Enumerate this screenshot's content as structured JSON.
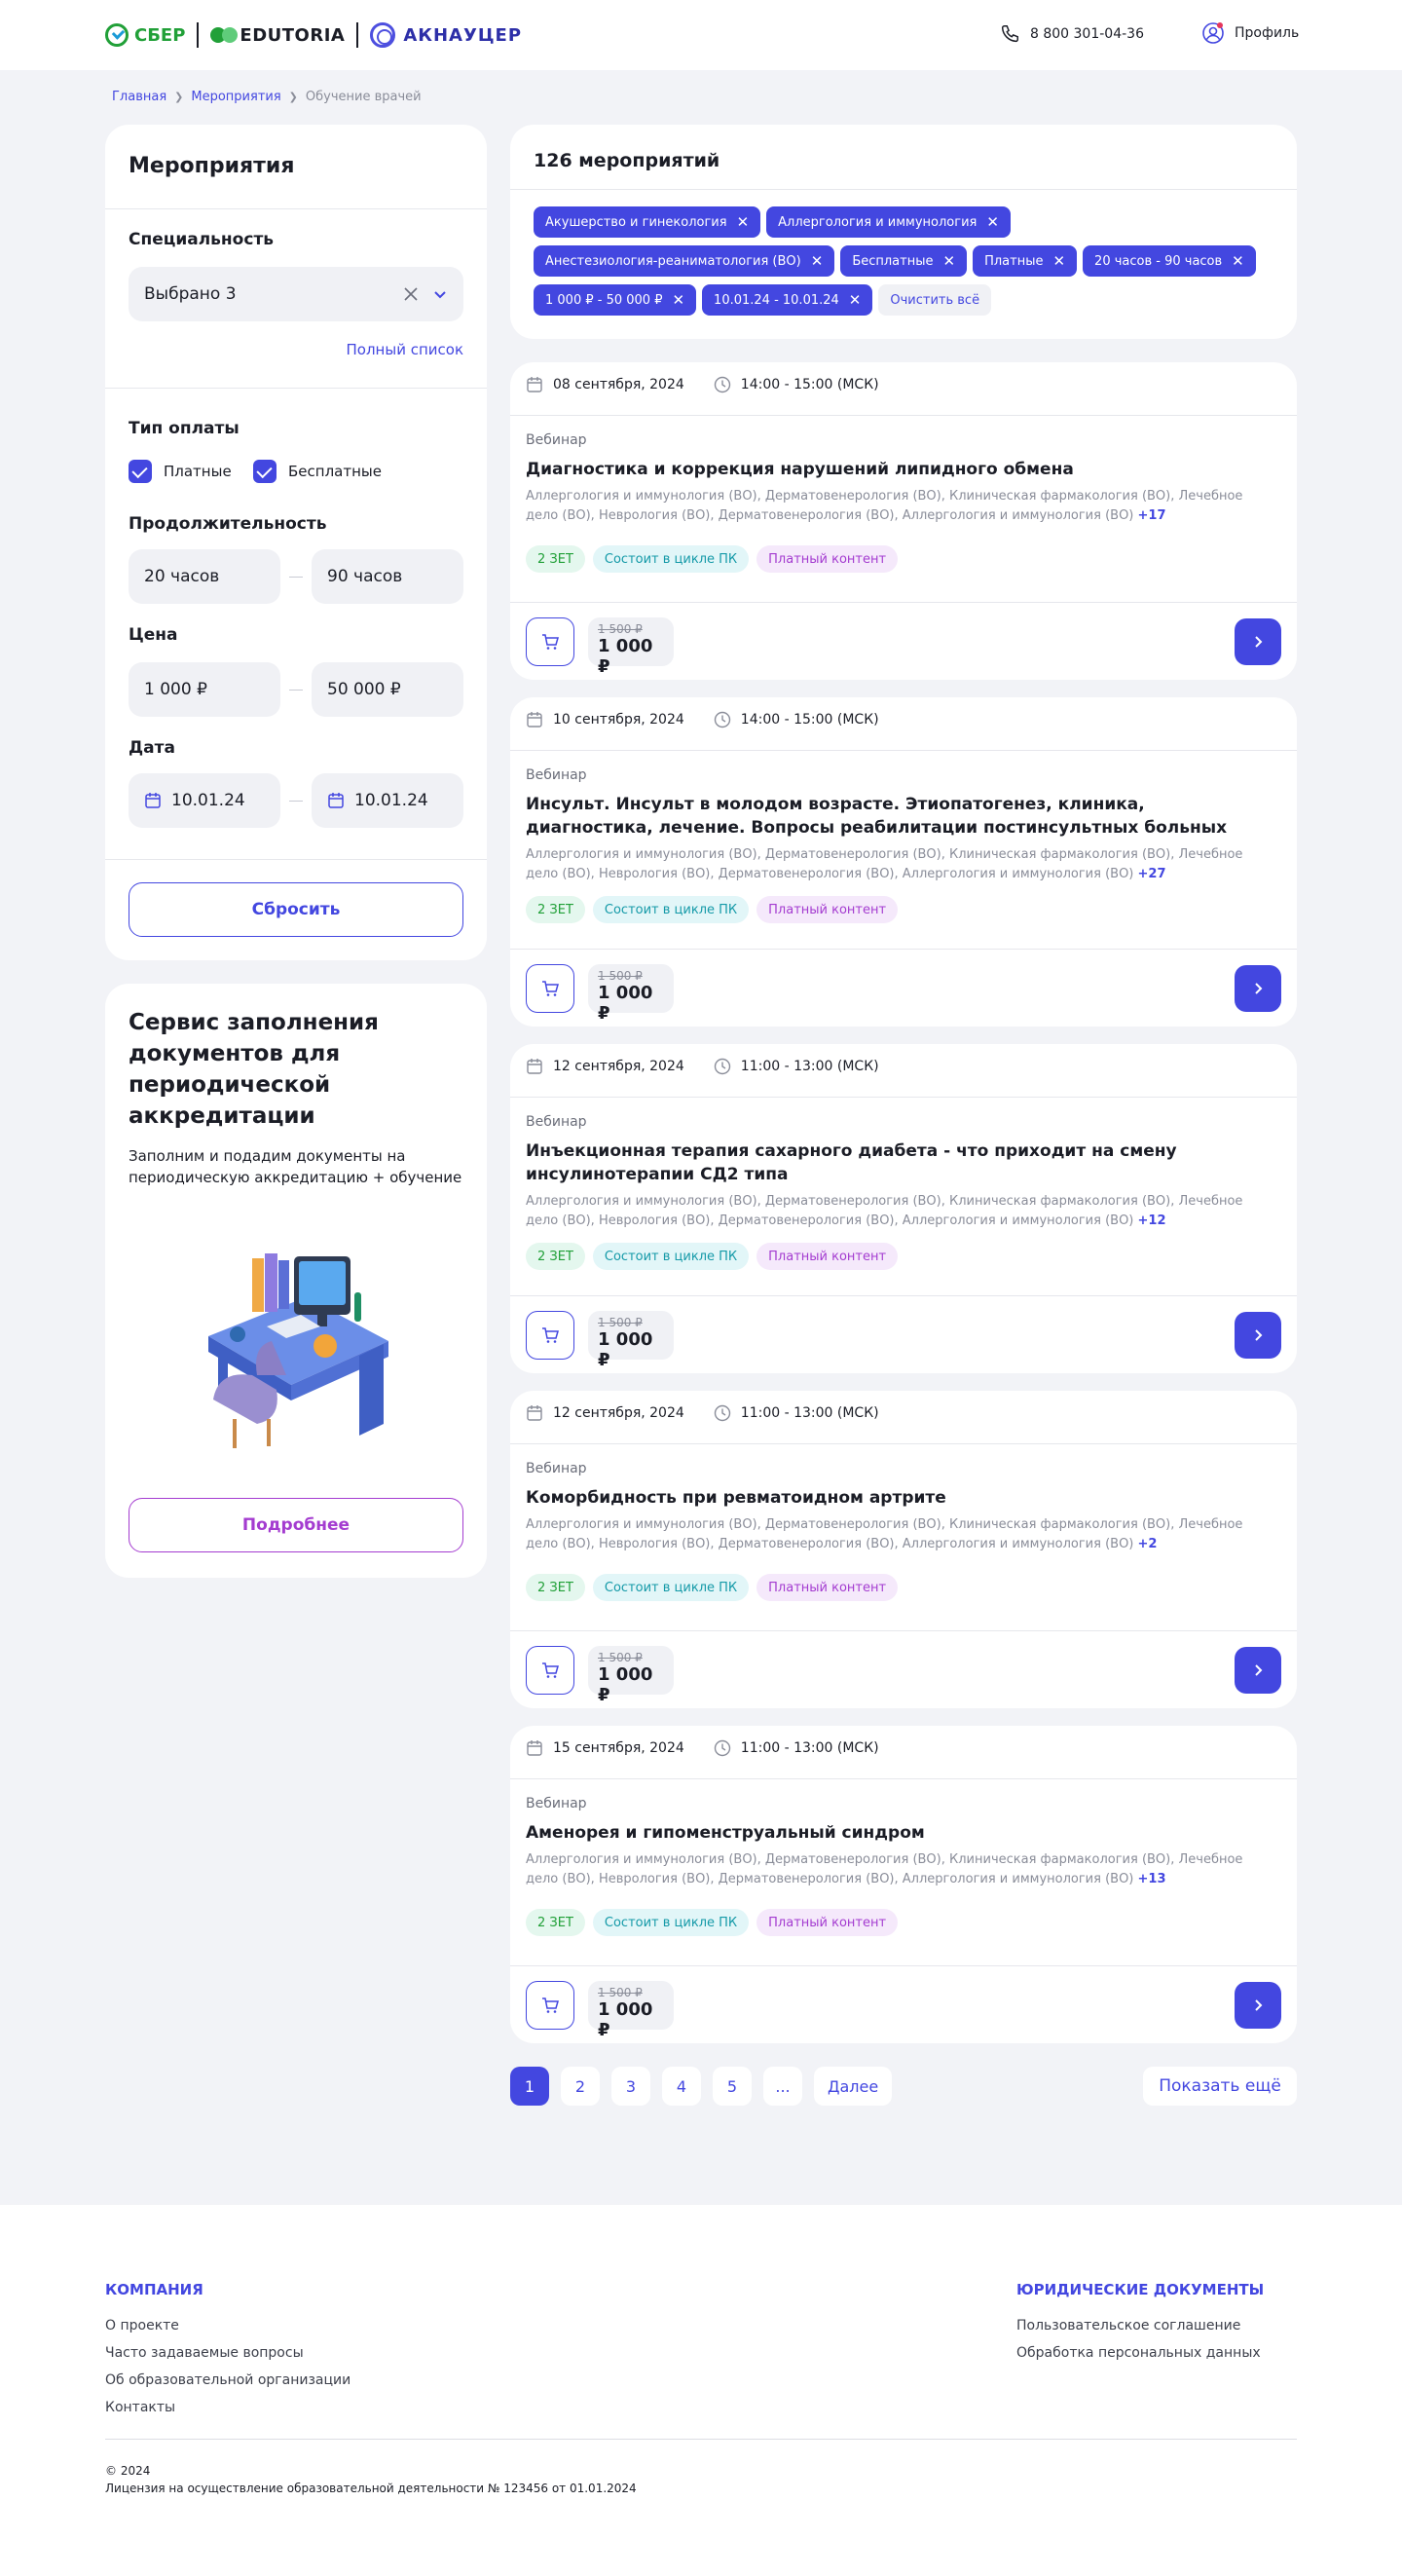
{
  "header": {
    "logo_sber": "СБЕР",
    "logo_edutoria": "EDUTORIA",
    "logo_aknaucer": "АКНАУЦЕР",
    "phone": "8 800 301-04-36",
    "profile": "Профиль"
  },
  "breadcrumb": {
    "home": "Главная",
    "events": "Мероприятия",
    "current": "Обучение врачей"
  },
  "filters": {
    "title": "Мероприятия",
    "speciality_label": "Специальность",
    "speciality_value": "Выбрано 3",
    "full_list": "Полный список",
    "payment_label": "Тип оплаты",
    "paid": "Платные",
    "free": "Бесплатные",
    "duration_label": "Продолжительность",
    "duration_from": "20 часов",
    "duration_to": "90 часов",
    "price_label": "Цена",
    "price_from": "1 000 ₽",
    "price_to": "50 000 ₽",
    "date_label": "Дата",
    "date_from": "10.01.24",
    "date_to": "10.01.24",
    "reset": "Сбросить"
  },
  "promo": {
    "title": "Сервис заполнения документов для периодической аккредитации",
    "text": "Заполним и подадим документы на периодическую аккредитацию + обучение",
    "button": "Подробнее"
  },
  "results": {
    "count": "126 мероприятий",
    "chips": [
      "Акушерство и гинекология",
      "Аллергология и иммунология",
      "Анестезиология-реаниматология (ВО)",
      "Бесплатные",
      "Платные",
      "20 часов - 90 часов",
      "1 000 ₽ - 50 000 ₽",
      "10.01.24 - 10.01.24"
    ],
    "clear_all": "Очистить всё"
  },
  "events": [
    {
      "date": "08 сентября, 2024",
      "time": "14:00 - 15:00 (МСК)",
      "type": "Вебинар",
      "title": "Диагностика и коррекция нарушений липидного обмена",
      "specs": "Аллергология и иммунология (ВО), Дерматовенерология (ВО), Клиническая фармакология (ВО), Лечебное дело (ВО), Неврология (ВО), Дерматовенерология (ВО), Аллергология и иммунология (ВО)",
      "more": "+17",
      "tag1": "2 ЗЕТ",
      "tag2": "Состоит в цикле ПК",
      "tag3": "Платный контент",
      "old_price": "1 500 ₽",
      "price": "1 000 ₽"
    },
    {
      "date": "10 сентября, 2024",
      "time": "14:00 - 15:00 (МСК)",
      "type": "Вебинар",
      "title": "Инсульт. Инсульт в молодом возрасте. Этиопатогенез, клиника, диагностика, лечение. Вопросы реабилитации постинсультных больных",
      "specs": "Аллергология и иммунология (ВО), Дерматовенерология (ВО), Клиническая фармакология (ВО), Лечебное дело (ВО), Неврология (ВО), Дерматовенерология (ВО), Аллергология и иммунология (ВО)",
      "more": "+27",
      "tag1": "2 ЗЕТ",
      "tag2": "Состоит в цикле ПК",
      "tag3": "Платный контент",
      "old_price": "1 500 ₽",
      "price": "1 000 ₽"
    },
    {
      "date": "12 сентября, 2024",
      "time": "11:00 - 13:00 (МСК)",
      "type": "Вебинар",
      "title": "Инъекционная терапия сахарного диабета - что приходит на смену инсулинотерапии СД2 типа",
      "specs": "Аллергология и иммунология (ВО), Дерматовенерология (ВО), Клиническая фармакология (ВО), Лечебное дело (ВО), Неврология (ВО), Дерматовенерология (ВО), Аллергология и иммунология (ВО)",
      "more": "+12",
      "tag1": "2 ЗЕТ",
      "tag2": "Состоит в цикле ПК",
      "tag3": "Платный контент",
      "old_price": "1 500 ₽",
      "price": "1 000 ₽"
    },
    {
      "date": "12 сентября, 2024",
      "time": "11:00 - 13:00 (МСК)",
      "type": "Вебинар",
      "title": "Коморбидность при ревматоидном артрите",
      "specs": "Аллергология и иммунология (ВО), Дерматовенерология (ВО), Клиническая фармакология (ВО), Лечебное дело (ВО), Неврология (ВО), Дерматовенерология (ВО), Аллергология и иммунология (ВО)",
      "more": "+2",
      "tag1": "2 ЗЕТ",
      "tag2": "Состоит в цикле ПК",
      "tag3": "Платный контент",
      "old_price": "1 500 ₽",
      "price": "1 000 ₽"
    },
    {
      "date": "15 сентября, 2024",
      "time": "11:00 - 13:00 (МСК)",
      "type": "Вебинар",
      "title": "Аменорея и гипоменструальный синдром",
      "specs": "Аллергология и иммунология (ВО), Дерматовенерология (ВО), Клиническая фармакология (ВО), Лечебное дело (ВО), Неврология (ВО), Дерматовенерология (ВО), Аллергология и иммунология (ВО)",
      "more": "+13",
      "tag1": "2 ЗЕТ",
      "tag2": "Состоит в цикле ПК",
      "tag3": "Платный контент",
      "old_price": "1 500 ₽",
      "price": "1 000 ₽"
    }
  ],
  "pagination": {
    "pages": [
      "1",
      "2",
      "3",
      "4",
      "5",
      "..."
    ],
    "next": "Далее",
    "show_more": "Показать ещё"
  },
  "footer": {
    "company_title": "КОМПАНИЯ",
    "company_links": [
      "О проекте",
      "Часто задаваемые вопросы",
      "Об образовательной организации",
      "Контакты"
    ],
    "legal_title": "ЮРИДИЧЕСКИЕ ДОКУМЕНТЫ",
    "legal_links": [
      "Пользовательское соглашение",
      "Обработка персональных данных"
    ],
    "copyright": "© 2024",
    "license": "Лицензия на осуществление образовательной деятельности № 123456 от 01.01.2024"
  },
  "colors": {
    "accent": "#4347e0",
    "background": "#f2f3f7",
    "green": "#21a038"
  }
}
